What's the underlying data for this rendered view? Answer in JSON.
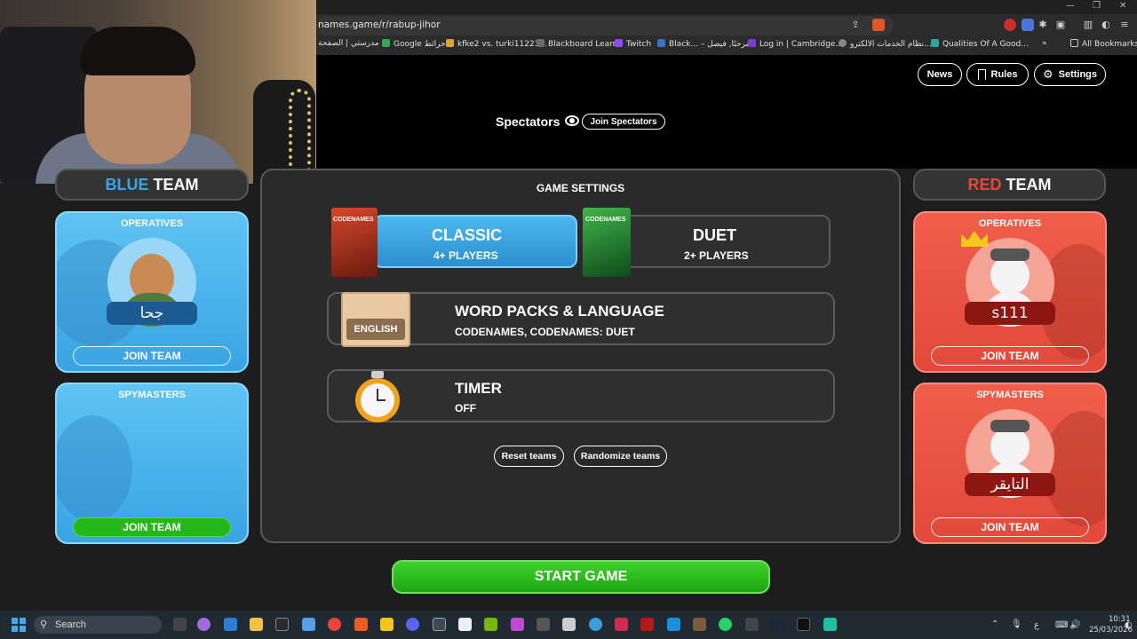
{
  "browser": {
    "url": "names.game/r/rabup-jihor",
    "bookmarks": [
      "مدرستي | الصفحة",
      "Google خرائط",
      "kfke2 vs. turki11223...",
      "Blackboard Learn",
      "Twitch",
      "Black... – مرحبًا, فيصل",
      "Log in | Cambridge...",
      "نظام الخدمات الالكترو...",
      "Qualities Of A Good...",
      "»",
      "All Bookmarks"
    ]
  },
  "header": {
    "news": "News",
    "rules": "Rules",
    "settings": "Settings",
    "spectators": "Spectators",
    "join_spectators": "Join Spectators"
  },
  "blue_team": {
    "title_part1": "BLUE",
    "title_part2": " TEAM",
    "operatives_label": "OPERATIVES",
    "operative_name": "جحا",
    "join_team": "JOIN TEAM",
    "spymasters_label": "SPYMASTERS",
    "spymaster_join": "JOIN TEAM"
  },
  "red_team": {
    "title_part1": "RED",
    "title_part2": " TEAM",
    "operatives_label": "OPERATIVES",
    "operative_name": "s111",
    "join_team": "JOIN TEAM",
    "spymasters_label": "SPYMASTERS",
    "spymaster_name": "التايقر",
    "spymaster_join": "JOIN TEAM"
  },
  "game_settings": {
    "title": "GAME SETTINGS",
    "classic": {
      "name": "CLASSIC",
      "players": "4+ PLAYERS",
      "box_text": "CODENAMES"
    },
    "duet": {
      "name": "DUET",
      "players": "2+ PLAYERS",
      "box_text": "CODENAMES"
    },
    "word_packs": {
      "title": "WORD PACKS & LANGUAGE",
      "value": "CODENAMES, CODENAMES: DUET",
      "badge": "ENGLISH"
    },
    "timer": {
      "title": "TIMER",
      "value": "OFF"
    },
    "reset_teams": "Reset teams",
    "randomize_teams": "Randomize teams",
    "start_game": "START GAME"
  },
  "taskbar": {
    "search": "Search",
    "time": "10:31",
    "date": "25/03/2026",
    "lang": "ع"
  },
  "colors": {
    "blue_team": "#3aa3e4",
    "red_team": "#e2493a",
    "start_green": "#25b81a",
    "name_tag_blue": "#1b5b92",
    "name_tag_red": "#8b1612"
  }
}
